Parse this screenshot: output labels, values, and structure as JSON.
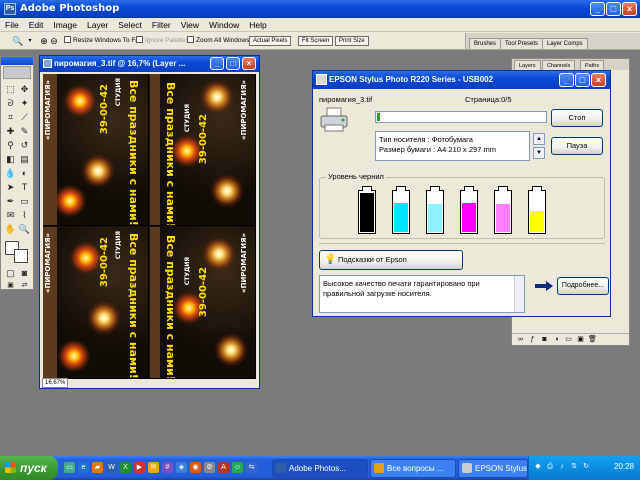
{
  "app": {
    "title": "Adobe Photoshop",
    "icon_label": "Ps"
  },
  "menu": [
    "File",
    "Edit",
    "Image",
    "Layer",
    "Select",
    "Filter",
    "View",
    "Window",
    "Help"
  ],
  "options_bar": {
    "resize_windows": "Resize Windows To Fit",
    "ignore_palettes": "Ignore Palettes",
    "zoom_all": "Zoom All Windows",
    "actual_pixels": "Actual Pixels",
    "fit_screen": "Fit Screen",
    "print_size": "Print Size"
  },
  "palette_well": [
    "Brushes",
    "Tool Presets",
    "Layer Comps"
  ],
  "palette_tabs": [
    "Layers",
    "Channels",
    "Paths"
  ],
  "document": {
    "title": "пиромагия_3.tif @ 16,7% (Layer ...",
    "zoom": "16,67%",
    "poster_slogan": "Все праздники с нами!",
    "poster_studio": "СТУДИЯ",
    "poster_brand": "«ПИРОМАГИЯ»",
    "poster_phone": "39-00-42"
  },
  "printer_dialog": {
    "title": "EPSON Stylus Photo R220 Series - USB002",
    "filename": "пиромагия_3.tif",
    "page": "Страница:0/5",
    "progress_fraction": 0.02,
    "media_type": "Тип носителя : Фотобумага",
    "paper_size": "Размер бумаги : A4 210 x 297 mm",
    "stop_button": "Стоп",
    "pause_button": "Пауза",
    "ink_group": "Уровень чернил",
    "inks": [
      {
        "color": "#000000",
        "level": 0.98
      },
      {
        "color": "#00e5ff",
        "level": 0.72
      },
      {
        "color": "#8ff0ff",
        "level": 0.7
      },
      {
        "color": "#ff00ff",
        "level": 0.72
      },
      {
        "color": "#ff80ff",
        "level": 0.7
      },
      {
        "color": "#ffff00",
        "level": 0.52
      }
    ],
    "tips_button": "Подсказки от Epson",
    "tips_line1": "Высокое качество печати гарантировано при",
    "tips_line2": "правильной загрузке носителя.",
    "details_button": "Подробнее..."
  },
  "taskbar": {
    "start": "пуск",
    "tasks": [
      "Adobe Photos...",
      "Все вопросы ...",
      "EPSON Stylus ..."
    ],
    "lang": "RU",
    "clock": "20:28"
  },
  "colors": {
    "xp_blue": "#0a49d6",
    "start_green": "#3c9a32",
    "progress_green": "#2aa12a"
  }
}
